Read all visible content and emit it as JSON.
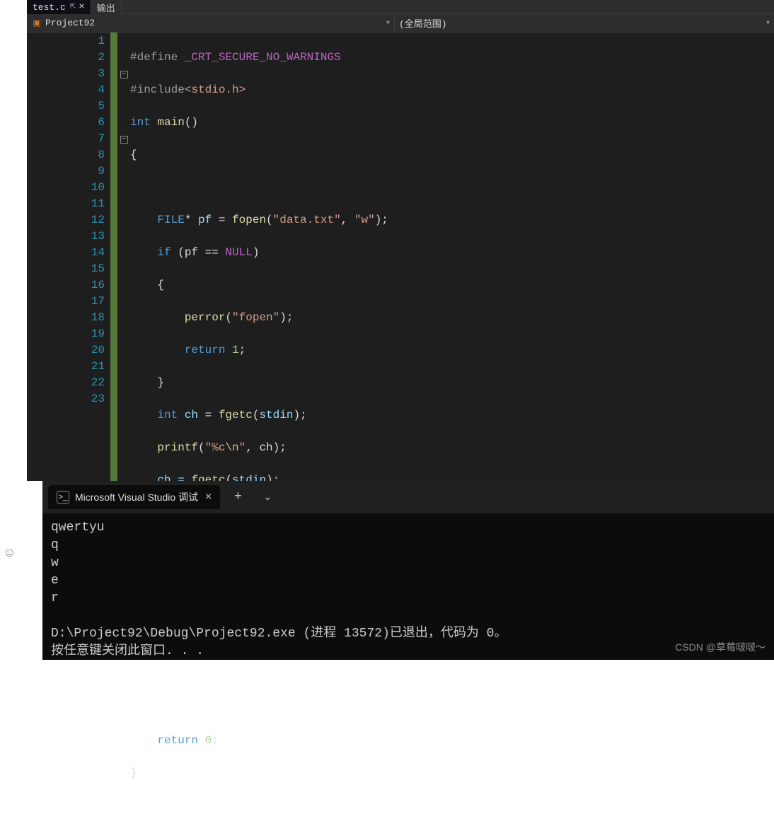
{
  "tabs": {
    "active": "test.c",
    "output": "输出"
  },
  "dropdowns": {
    "project": "Project92",
    "scope": "(全局范围)"
  },
  "code": {
    "line_count": 23,
    "lines": {
      "l1_define": "#define ",
      "l1_macro": "_CRT_SECURE_NO_WARNINGS",
      "l2_include": "#include",
      "l2_hdr": "<stdio.h>",
      "l3_int": "int",
      "l3_main": " main",
      "l3_paren": "()",
      "l4": "{",
      "l6_FILE": "FILE",
      "l6_star": "*",
      "l6_pf": " pf ",
      "l6_eq": "= ",
      "l6_fopen": "fopen",
      "l6_op": "(",
      "l6_s1": "\"data.txt\"",
      "l6_cm": ", ",
      "l6_s2": "\"w\"",
      "l6_cp": ");",
      "l7_if": "if",
      "l7_rest": " (pf == ",
      "l7_null": "NULL",
      "l7_cp": ")",
      "l8": "{",
      "l9_perror": "perror",
      "l9_op": "(",
      "l9_str": "\"fopen\"",
      "l9_cp": ");",
      "l10_ret": "return",
      "l10_sp": " ",
      "l10_n": "1",
      "l10_sc": ";",
      "l11": "}",
      "l12_int": "int",
      "l12_ch": " ch ",
      "l12_eq": "= ",
      "l12_fgetc": "fgetc",
      "l12_op": "(",
      "l12_stdin": "stdin",
      "l12_cp": ");",
      "printf": "printf",
      "p_op": "(",
      "p_str_a": "\"%c",
      "p_esc": "\\n",
      "p_str_b": "\"",
      "p_cm": ", ch);",
      "assign": "ch = ",
      "fgetc": "fgetc",
      "fg_op": "(",
      "fg_stdin": "stdin",
      "fg_cp": ");",
      "l22_ret": "return",
      "l22_n": " 0",
      "l22_sc": ";",
      "l23": "}"
    }
  },
  "terminal": {
    "tab_title": "Microsoft Visual Studio 调试",
    "output": "qwertyu\nq\nw\ne\nr\n\nD:\\Project92\\Debug\\Project92.exe (进程 13572)已退出，代码为 0。\n按任意键关闭此窗口. . ."
  },
  "watermark": "CSDN @草莓啵啵～"
}
